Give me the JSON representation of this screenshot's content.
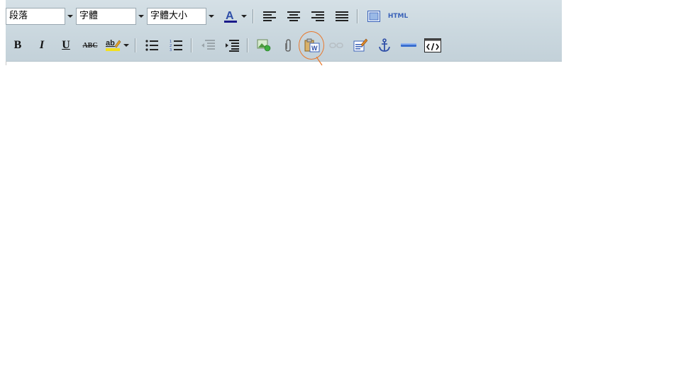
{
  "toolbar": {
    "row1": {
      "format_select": "段落",
      "font_select": "字體",
      "size_select": "字體大小",
      "html_label": "HTML"
    },
    "row2": {
      "bold": "B",
      "italic": "I",
      "underline": "U",
      "strike": "ABC",
      "highlight_text": "ab"
    }
  },
  "colors": {
    "toolbar_bg": "#cbd8df",
    "annotation_circle": "#e8782c",
    "icon_blue": "#3a62b8"
  }
}
